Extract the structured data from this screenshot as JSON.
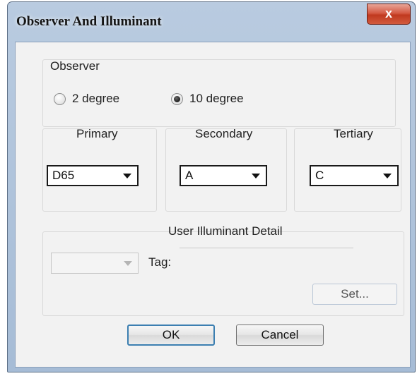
{
  "window": {
    "title": "Observer And Illuminant",
    "close_glyph": "x"
  },
  "observer": {
    "group_label": "Observer",
    "options": [
      {
        "label": "2 degree",
        "selected": false
      },
      {
        "label": "10 degree",
        "selected": true
      }
    ]
  },
  "illuminants": {
    "primary": {
      "label": "Primary",
      "value": "D65"
    },
    "secondary": {
      "label": "Secondary",
      "value": "A"
    },
    "tertiary": {
      "label": "Tertiary",
      "value": "C"
    }
  },
  "user_detail": {
    "label": "User Illuminant Detail",
    "combo_value": "",
    "tag_label": "Tag:",
    "set_button": "Set..."
  },
  "buttons": {
    "ok": "OK",
    "cancel": "Cancel"
  },
  "colors": {
    "title_bar": "#a6bcd6",
    "close_button": "#c0391f",
    "default_button_border": "#3c7fb1"
  }
}
